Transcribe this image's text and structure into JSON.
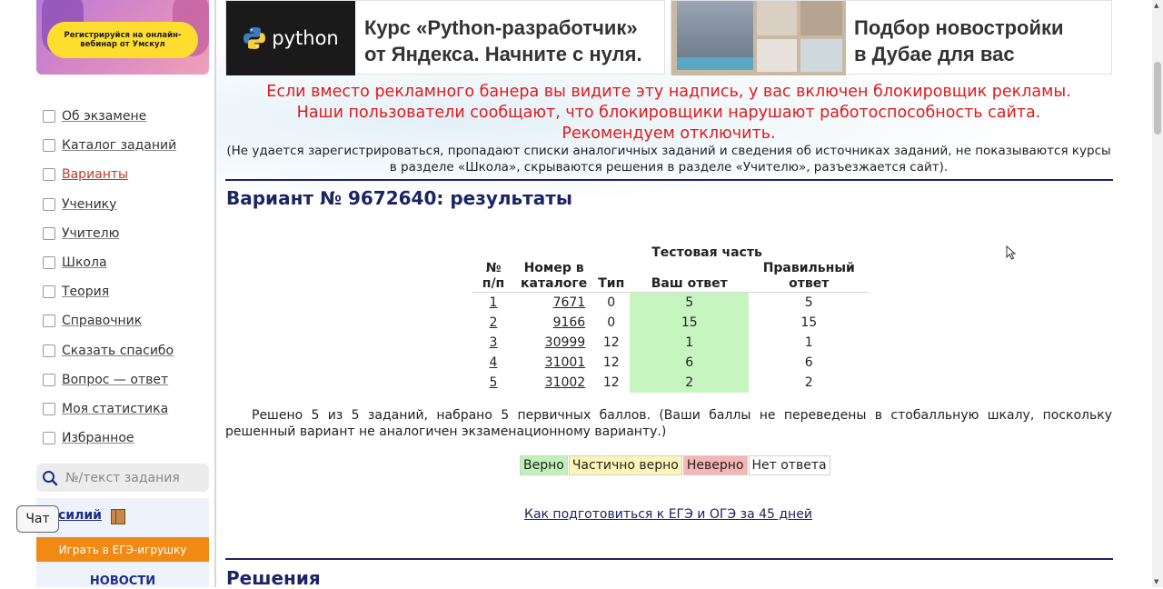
{
  "promo": {
    "text": "Регистрируйся на онлайн-вебинар от Умскул"
  },
  "sidebar": {
    "items": [
      {
        "label": "Об экзамене"
      },
      {
        "label": "Каталог заданий"
      },
      {
        "label": "Варианты",
        "active": true
      },
      {
        "label": "Ученику"
      },
      {
        "label": "Учителю"
      },
      {
        "label": "Школа"
      },
      {
        "label": "Теория"
      },
      {
        "label": "Справочник"
      },
      {
        "label": "Сказать спасибо"
      },
      {
        "label": "Вопрос — ответ"
      },
      {
        "label": "Моя статистика"
      },
      {
        "label": "Избранное"
      }
    ],
    "search_placeholder": "№/текст задания",
    "user_name": "силий",
    "game_button": "Играть в ЕГЭ-игрушку",
    "news": "НОВОСТИ"
  },
  "chat": {
    "label": "Чат"
  },
  "ads": {
    "ad1": {
      "logo": "python",
      "text_line1": "Курс «Python-разработчик»",
      "text_line2": "от Яндекса. Начните с нуля."
    },
    "ad2": {
      "text_line1": "Подбор новостройки",
      "text_line2": "в Дубае для вас"
    }
  },
  "warning": {
    "line1": "Если вместо рекламного банера вы видите эту надпись, у вас включен блокировщик рекламы.",
    "line2": "Наши пользователи сообщают, что блокировщики нарушают работоспособность сайта.",
    "line3": "Рекомендуем отключить.",
    "note": "(Не удается зарегистрироваться, пропадают списки аналогичных заданий и сведения об источниках заданий, не показываются курсы в разделе «Школа», скрываются решения в разделе «Учителю», разъезжается сайт)."
  },
  "main": {
    "title": "Вариант № 9672640: результаты",
    "table": {
      "group_header": "Тестовая часть",
      "headers": {
        "num": "№ п/п",
        "catalog": "Номер в каталоге",
        "type": "Тип",
        "answer": "Ваш ответ",
        "correct": "Правильный ответ"
      },
      "rows": [
        {
          "num": "1",
          "catalog": "7671",
          "type": "0",
          "answer": "5",
          "correct": "5"
        },
        {
          "num": "2",
          "catalog": "9166",
          "type": "0",
          "answer": "15",
          "correct": "15"
        },
        {
          "num": "3",
          "catalog": "30999",
          "type": "12",
          "answer": "1",
          "correct": "1"
        },
        {
          "num": "4",
          "catalog": "31001",
          "type": "12",
          "answer": "6",
          "correct": "6"
        },
        {
          "num": "5",
          "catalog": "31002",
          "type": "12",
          "answer": "2",
          "correct": "2"
        }
      ]
    },
    "summary": "Решено 5 из 5 заданий, набрано 5 первичных баллов. (Ваши баллы не переведены в стобалльную шкалу, поскольку решенный вариант не аналогичен экзаменационному варианту.)",
    "legend": {
      "correct": "Верно",
      "partial": "Частично верно",
      "wrong": "Неверно",
      "none": "Нет ответа"
    },
    "prep_link": "Как подготовиться к ЕГЭ и ОГЭ за 45 дней",
    "solutions_title": "Решения"
  },
  "colors": {
    "title": "#1c2463",
    "warning": "#e01b1b",
    "answer_cell": "#c7f5c0",
    "game_button": "#f18a12"
  }
}
